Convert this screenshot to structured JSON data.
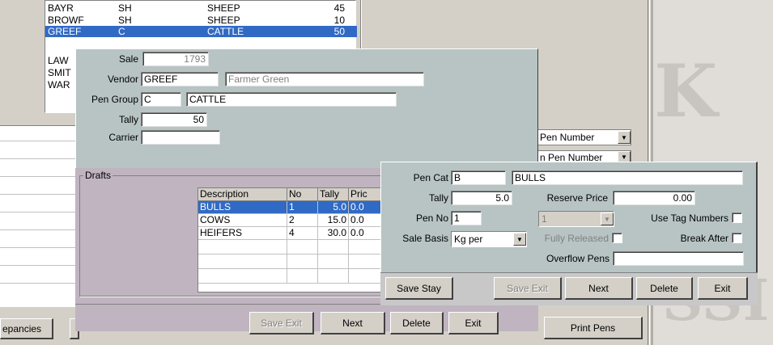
{
  "background_list": {
    "rows": [
      {
        "code": "BAYR",
        "group": "SH",
        "name": "SHEEP",
        "count": "45"
      },
      {
        "code": "BROWF",
        "group": "SH",
        "name": "SHEEP",
        "count": "10"
      },
      {
        "code": "GREEF",
        "group": "C",
        "name": "CATTLE",
        "count": "50"
      },
      {
        "code": "LAW",
        "group": "",
        "name": "",
        "count": ""
      },
      {
        "code": "SMIT",
        "group": "",
        "name": "",
        "count": ""
      },
      {
        "code": "WAR",
        "group": "",
        "name": "",
        "count": ""
      }
    ],
    "selected_index": 2
  },
  "discrepancies_button": "epancies",
  "right_panel": {
    "pen_number_dropdown1": "Pen Number",
    "pen_number_dropdown2": "n Pen Number",
    "print_pens_button": "Print Pens"
  },
  "watermark_text_top": "K",
  "watermark_text_bottom": "SSI",
  "sale_dialog": {
    "sale_label": "Sale",
    "sale_value": "1793",
    "vendor_label": "Vendor",
    "vendor_code": "GREEF",
    "vendor_name": "Farmer Green",
    "pen_group_label": "Pen Group",
    "pen_group_code": "C",
    "pen_group_name": "CATTLE",
    "tally_label": "Tally",
    "tally_value": "50",
    "carrier_label": "Carrier",
    "carrier_value": "",
    "drafts_label": "Drafts",
    "drafts_grid": {
      "headers": [
        "Description",
        "No",
        "Tally",
        "Pric"
      ],
      "rows": [
        [
          "BULLS",
          "1",
          "5.0",
          "0.0"
        ],
        [
          "COWS",
          "2",
          "15.0",
          "0.0"
        ],
        [
          "HEIFERS",
          "4",
          "30.0",
          "0.0"
        ]
      ],
      "selected_index": 0
    },
    "buttons": {
      "save_exit": "Save Exit",
      "next": "Next",
      "delete": "Delete",
      "exit": "Exit"
    }
  },
  "pen_dialog": {
    "pen_cat_label": "Pen Cat",
    "pen_cat_code": "B",
    "pen_cat_name": "BULLS",
    "tally_label": "Tally",
    "tally_value": "5.0",
    "reserve_price_label": "Reserve Price",
    "reserve_price_value": "0.00",
    "pen_no_label": "Pen No",
    "pen_no_value": "1",
    "pen_no_select": "1",
    "use_tag_numbers_label": "Use Tag Numbers",
    "sale_basis_label": "Sale Basis",
    "sale_basis_value": "Kg per",
    "fully_released_label": "Fully Released",
    "break_after_label": "Break After",
    "overflow_pens_label": "Overflow Pens",
    "overflow_pens_value": "",
    "buttons": {
      "save_stay": "Save Stay",
      "save_exit": "Save Exit",
      "next": "Next",
      "delete": "Delete",
      "exit": "Exit"
    }
  }
}
